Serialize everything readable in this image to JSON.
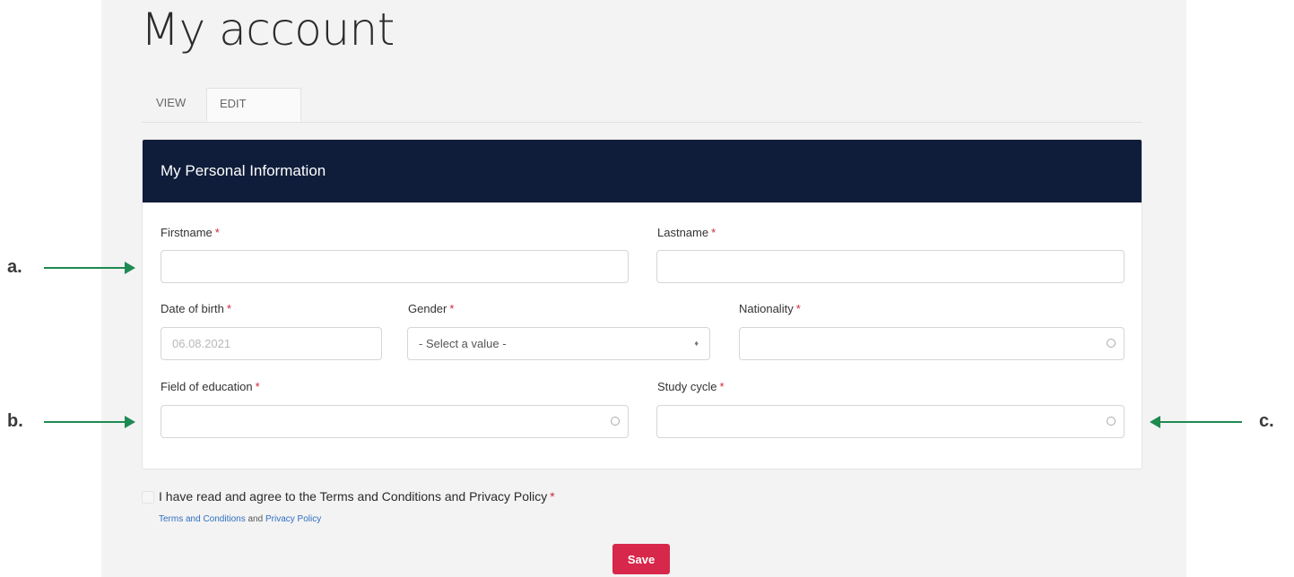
{
  "page": {
    "title": "My account"
  },
  "tabs": [
    {
      "label": "VIEW",
      "active": false
    },
    {
      "label": "EDIT",
      "active": true
    }
  ],
  "form": {
    "section_title": "My Personal Information",
    "required_marker": "*",
    "fields": {
      "firstname": {
        "label": "Firstname",
        "value": ""
      },
      "lastname": {
        "label": "Lastname",
        "value": ""
      },
      "date_of_birth": {
        "label": "Date of birth",
        "placeholder": "06.08.2021"
      },
      "gender": {
        "label": "Gender",
        "selected": "- Select a value -"
      },
      "nationality": {
        "label": "Nationality",
        "value": ""
      },
      "field_of_education": {
        "label": "Field of education",
        "value": ""
      },
      "study_cycle": {
        "label": "Study cycle",
        "value": ""
      }
    },
    "consent": {
      "text": "I have read and agree to the Terms and Conditions and Privacy Policy",
      "terms_link": "Terms and Conditions",
      "and_text": "and",
      "privacy_link": "Privacy Policy"
    },
    "save_label": "Save"
  },
  "annotations": {
    "a": "a.",
    "b": "b.",
    "c": "c."
  },
  "colors": {
    "header_bg": "#0f1d3a",
    "save_button": "#d7274a",
    "required": "#d0273d",
    "arrow": "#1e8a52",
    "link": "#2f6fc2"
  }
}
